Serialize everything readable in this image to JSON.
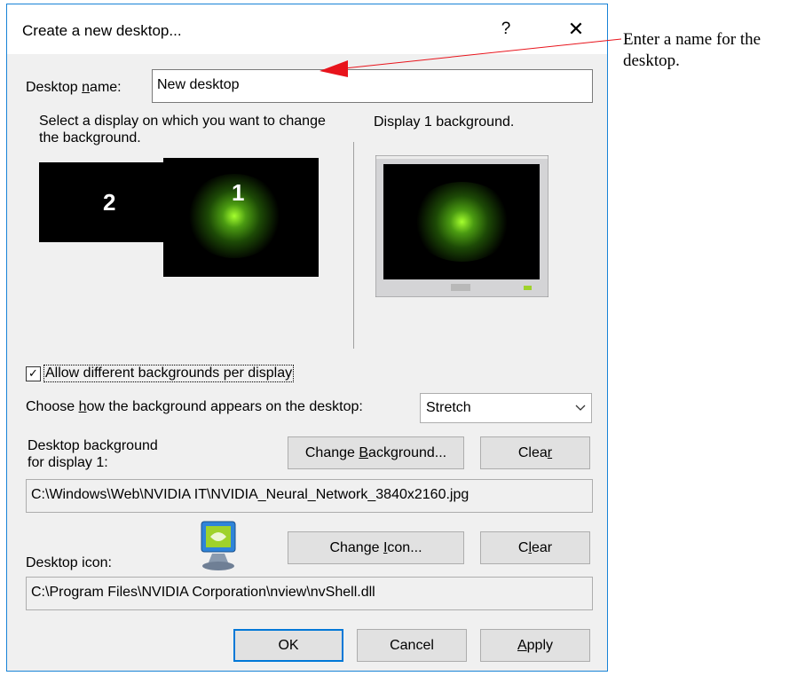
{
  "dialog": {
    "title": "Create a new desktop...",
    "help_label": "?",
    "close_label": "✕"
  },
  "desktop_name": {
    "label_prefix": "Desktop ",
    "label_accel": "n",
    "label_suffix": "ame:",
    "value": "New desktop"
  },
  "display_select": {
    "instruction": "Select a display on which you want to change the background.",
    "display_2_label": "2",
    "display_1_label": "1",
    "preview_title": "Display 1 background."
  },
  "allow_different": {
    "checked": true,
    "label": "Allow different backgrounds per display"
  },
  "background_mode": {
    "label_prefix": "Choose ",
    "label_accel": "h",
    "label_suffix": "ow the background appears on the desktop:",
    "selected": "Stretch"
  },
  "desktop_background": {
    "label_line1": "Desktop background",
    "label_line2": "for display 1:",
    "change_prefix": "Change ",
    "change_accel": "B",
    "change_suffix": "ackground...",
    "clear_prefix": "Clea",
    "clear_accel": "r",
    "clear_suffix": "",
    "path": "C:\\Windows\\Web\\NVIDIA IT\\NVIDIA_Neural_Network_3840x2160.jpg"
  },
  "desktop_icon": {
    "label": "Desktop icon:",
    "change_prefix": "Change ",
    "change_accel": "I",
    "change_suffix": "con...",
    "clear_prefix": "C",
    "clear_accel": "l",
    "clear_suffix": "ear",
    "path": "C:\\Program Files\\NVIDIA Corporation\\nview\\nvShell.dll"
  },
  "footer": {
    "ok": "OK",
    "cancel": "Cancel",
    "apply_accel": "A",
    "apply_suffix": "pply"
  },
  "annotation": {
    "text": "Enter a name for the desktop."
  },
  "colors": {
    "dialog_border": "#1883d7",
    "arrow": "#e8141c",
    "default_button_border": "#0078d7"
  }
}
